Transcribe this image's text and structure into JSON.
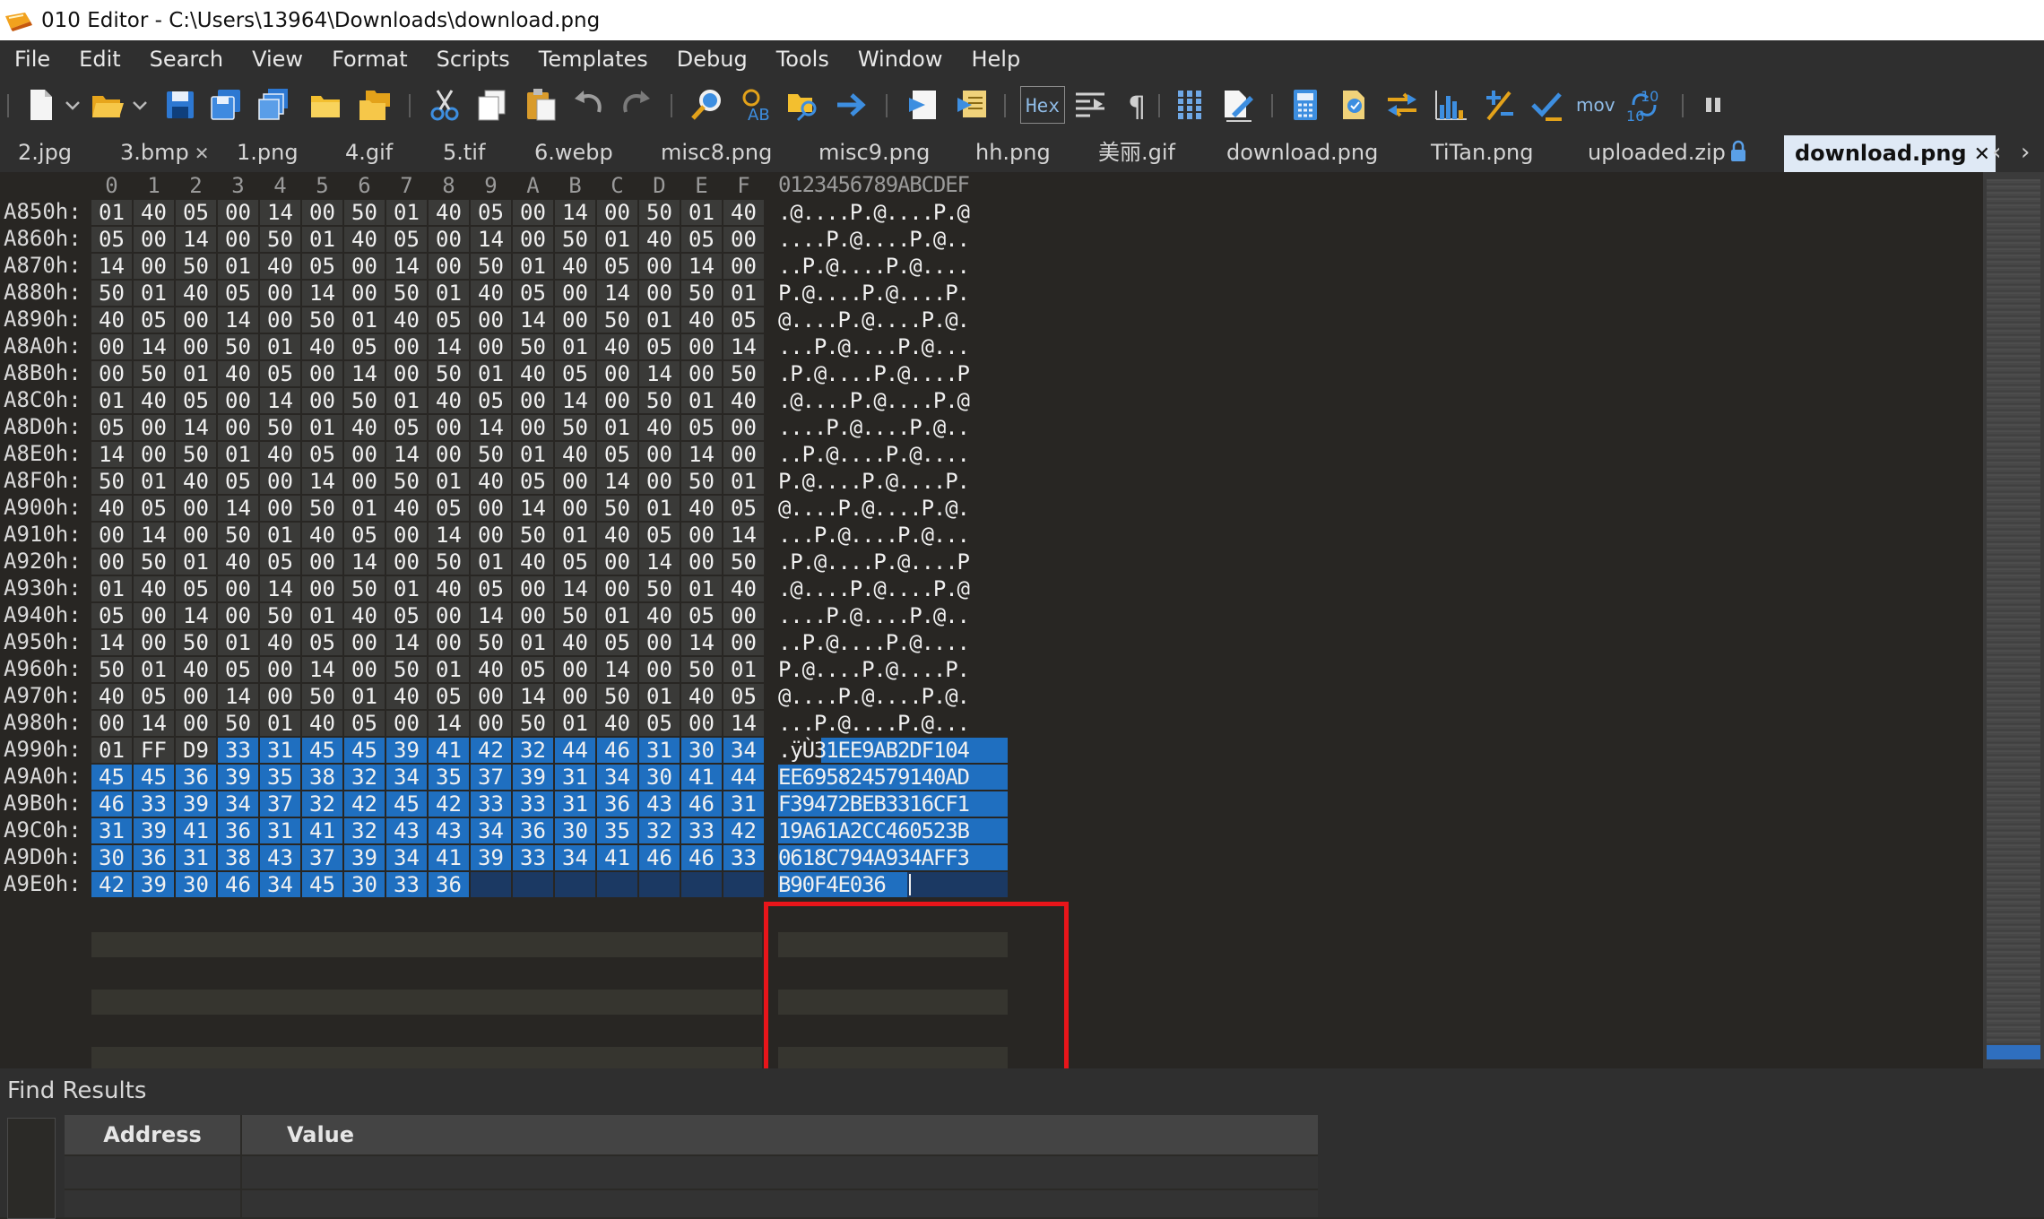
{
  "window": {
    "title": "010 Editor - C:\\Users\\13964\\Downloads\\download.png"
  },
  "menu": [
    "File",
    "Edit",
    "Search",
    "View",
    "Format",
    "Scripts",
    "Templates",
    "Debug",
    "Tools",
    "Window",
    "Help"
  ],
  "toolbar": {
    "hex_label": "Hex",
    "mov_label": "mov",
    "icons": [
      "new-file-icon",
      "new-dropdown-icon",
      "open-file-icon",
      "open-dropdown-icon",
      "save-icon",
      "save-as-icon",
      "save-all-icon",
      "open-folder-icon",
      "open-multiple-icon",
      "cut-icon",
      "copy-icon",
      "paste-icon",
      "undo-icon",
      "redo-icon",
      "find-icon",
      "replace-icon",
      "find-in-files-icon",
      "goto-icon",
      "bookmark-icon",
      "template-icon",
      "hex-toggle",
      "columns-icon",
      "show-whitespace-icon",
      "column-mode-icon",
      "highlight-icon",
      "calculator-icon",
      "compare-icon",
      "swap-bytes-icon",
      "histogram-icon",
      "checksum-icon",
      "checkmark-icon",
      "mov-icon",
      "base-converter-icon",
      "pause-icon"
    ]
  },
  "tabs": [
    {
      "label": "2.jpg",
      "active": false
    },
    {
      "label": "3.bmp",
      "active": false,
      "closable": true
    },
    {
      "label": "1.png",
      "active": false
    },
    {
      "label": "4.gif",
      "active": false
    },
    {
      "label": "5.tif",
      "active": false
    },
    {
      "label": "6.webp",
      "active": false
    },
    {
      "label": "misc8.png",
      "active": false
    },
    {
      "label": "misc9.png",
      "active": false
    },
    {
      "label": "hh.png",
      "active": false
    },
    {
      "label": "美丽.gif",
      "active": false
    },
    {
      "label": "download.png",
      "active": false
    },
    {
      "label": "TiTan.png",
      "active": false
    },
    {
      "label": "uploaded.zip",
      "active": false,
      "locked": true
    },
    {
      "label": "download.png",
      "active": true,
      "closable": true
    }
  ],
  "tab_nav": {
    "prev": "‹",
    "next": "›"
  },
  "hex_header": {
    "columns": [
      "0",
      "1",
      "2",
      "3",
      "4",
      "5",
      "6",
      "7",
      "8",
      "9",
      "A",
      "B",
      "C",
      "D",
      "E",
      "F"
    ],
    "ascii_header": "0123456789ABCDEF"
  },
  "hex_rows": [
    {
      "addr": "A850h:",
      "bytes": [
        "01",
        "40",
        "05",
        "00",
        "14",
        "00",
        "50",
        "01",
        "40",
        "05",
        "00",
        "14",
        "00",
        "50",
        "01",
        "40"
      ],
      "ascii": ".@....P.@....P.@"
    },
    {
      "addr": "A860h:",
      "bytes": [
        "05",
        "00",
        "14",
        "00",
        "50",
        "01",
        "40",
        "05",
        "00",
        "14",
        "00",
        "50",
        "01",
        "40",
        "05",
        "00"
      ],
      "ascii": "....P.@....P.@.."
    },
    {
      "addr": "A870h:",
      "bytes": [
        "14",
        "00",
        "50",
        "01",
        "40",
        "05",
        "00",
        "14",
        "00",
        "50",
        "01",
        "40",
        "05",
        "00",
        "14",
        "00"
      ],
      "ascii": "..P.@....P.@...."
    },
    {
      "addr": "A880h:",
      "bytes": [
        "50",
        "01",
        "40",
        "05",
        "00",
        "14",
        "00",
        "50",
        "01",
        "40",
        "05",
        "00",
        "14",
        "00",
        "50",
        "01"
      ],
      "ascii": "P.@....P.@....P."
    },
    {
      "addr": "A890h:",
      "bytes": [
        "40",
        "05",
        "00",
        "14",
        "00",
        "50",
        "01",
        "40",
        "05",
        "00",
        "14",
        "00",
        "50",
        "01",
        "40",
        "05"
      ],
      "ascii": "@....P.@....P.@."
    },
    {
      "addr": "A8A0h:",
      "bytes": [
        "00",
        "14",
        "00",
        "50",
        "01",
        "40",
        "05",
        "00",
        "14",
        "00",
        "50",
        "01",
        "40",
        "05",
        "00",
        "14"
      ],
      "ascii": "...P.@....P.@..."
    },
    {
      "addr": "A8B0h:",
      "bytes": [
        "00",
        "50",
        "01",
        "40",
        "05",
        "00",
        "14",
        "00",
        "50",
        "01",
        "40",
        "05",
        "00",
        "14",
        "00",
        "50"
      ],
      "ascii": ".P.@....P.@....P"
    },
    {
      "addr": "A8C0h:",
      "bytes": [
        "01",
        "40",
        "05",
        "00",
        "14",
        "00",
        "50",
        "01",
        "40",
        "05",
        "00",
        "14",
        "00",
        "50",
        "01",
        "40"
      ],
      "ascii": ".@....P.@....P.@"
    },
    {
      "addr": "A8D0h:",
      "bytes": [
        "05",
        "00",
        "14",
        "00",
        "50",
        "01",
        "40",
        "05",
        "00",
        "14",
        "00",
        "50",
        "01",
        "40",
        "05",
        "00"
      ],
      "ascii": "....P.@....P.@.."
    },
    {
      "addr": "A8E0h:",
      "bytes": [
        "14",
        "00",
        "50",
        "01",
        "40",
        "05",
        "00",
        "14",
        "00",
        "50",
        "01",
        "40",
        "05",
        "00",
        "14",
        "00"
      ],
      "ascii": "..P.@....P.@...."
    },
    {
      "addr": "A8F0h:",
      "bytes": [
        "50",
        "01",
        "40",
        "05",
        "00",
        "14",
        "00",
        "50",
        "01",
        "40",
        "05",
        "00",
        "14",
        "00",
        "50",
        "01"
      ],
      "ascii": "P.@....P.@....P."
    },
    {
      "addr": "A900h:",
      "bytes": [
        "40",
        "05",
        "00",
        "14",
        "00",
        "50",
        "01",
        "40",
        "05",
        "00",
        "14",
        "00",
        "50",
        "01",
        "40",
        "05"
      ],
      "ascii": "@....P.@....P.@."
    },
    {
      "addr": "A910h:",
      "bytes": [
        "00",
        "14",
        "00",
        "50",
        "01",
        "40",
        "05",
        "00",
        "14",
        "00",
        "50",
        "01",
        "40",
        "05",
        "00",
        "14"
      ],
      "ascii": "...P.@....P.@..."
    },
    {
      "addr": "A920h:",
      "bytes": [
        "00",
        "50",
        "01",
        "40",
        "05",
        "00",
        "14",
        "00",
        "50",
        "01",
        "40",
        "05",
        "00",
        "14",
        "00",
        "50"
      ],
      "ascii": ".P.@....P.@....P"
    },
    {
      "addr": "A930h:",
      "bytes": [
        "01",
        "40",
        "05",
        "00",
        "14",
        "00",
        "50",
        "01",
        "40",
        "05",
        "00",
        "14",
        "00",
        "50",
        "01",
        "40"
      ],
      "ascii": ".@....P.@....P.@"
    },
    {
      "addr": "A940h:",
      "bytes": [
        "05",
        "00",
        "14",
        "00",
        "50",
        "01",
        "40",
        "05",
        "00",
        "14",
        "00",
        "50",
        "01",
        "40",
        "05",
        "00"
      ],
      "ascii": "....P.@....P.@.."
    },
    {
      "addr": "A950h:",
      "bytes": [
        "14",
        "00",
        "50",
        "01",
        "40",
        "05",
        "00",
        "14",
        "00",
        "50",
        "01",
        "40",
        "05",
        "00",
        "14",
        "00"
      ],
      "ascii": "..P.@....P.@...."
    },
    {
      "addr": "A960h:",
      "bytes": [
        "50",
        "01",
        "40",
        "05",
        "00",
        "14",
        "00",
        "50",
        "01",
        "40",
        "05",
        "00",
        "14",
        "00",
        "50",
        "01"
      ],
      "ascii": "P.@....P.@....P."
    },
    {
      "addr": "A970h:",
      "bytes": [
        "40",
        "05",
        "00",
        "14",
        "00",
        "50",
        "01",
        "40",
        "05",
        "00",
        "14",
        "00",
        "50",
        "01",
        "40",
        "05"
      ],
      "ascii": "@....P.@....P.@."
    },
    {
      "addr": "A980h:",
      "bytes": [
        "00",
        "14",
        "00",
        "50",
        "01",
        "40",
        "05",
        "00",
        "14",
        "00",
        "50",
        "01",
        "40",
        "05",
        "00",
        "14"
      ],
      "ascii": "...P.@....P.@..."
    },
    {
      "addr": "A990h:",
      "bytes": [
        "01",
        "FF",
        "D9",
        "33",
        "31",
        "45",
        "45",
        "39",
        "41",
        "42",
        "32",
        "44",
        "46",
        "31",
        "30",
        "34"
      ],
      "ascii": ".ÿÙ31EE9AB2DF104",
      "sel_from": 3
    },
    {
      "addr": "A9A0h:",
      "bytes": [
        "45",
        "45",
        "36",
        "39",
        "35",
        "38",
        "32",
        "34",
        "35",
        "37",
        "39",
        "31",
        "34",
        "30",
        "41",
        "44"
      ],
      "ascii": "EE695824579140AD",
      "sel_from": 0
    },
    {
      "addr": "A9B0h:",
      "bytes": [
        "46",
        "33",
        "39",
        "34",
        "37",
        "32",
        "42",
        "45",
        "42",
        "33",
        "33",
        "31",
        "36",
        "43",
        "46",
        "31"
      ],
      "ascii": "F39472BEB3316CF1",
      "sel_from": 0
    },
    {
      "addr": "A9C0h:",
      "bytes": [
        "31",
        "39",
        "41",
        "36",
        "31",
        "41",
        "32",
        "43",
        "43",
        "34",
        "36",
        "30",
        "35",
        "32",
        "33",
        "42"
      ],
      "ascii": "19A61A2CC460523B",
      "sel_from": 0
    },
    {
      "addr": "A9D0h:",
      "bytes": [
        "30",
        "36",
        "31",
        "38",
        "43",
        "37",
        "39",
        "34",
        "41",
        "39",
        "33",
        "34",
        "41",
        "46",
        "46",
        "33"
      ],
      "ascii": "0618C794A934AFF3",
      "sel_from": 0
    },
    {
      "addr": "A9E0h:",
      "bytes": [
        "42",
        "39",
        "30",
        "46",
        "34",
        "45",
        "30",
        "33",
        "36"
      ],
      "ascii": "B90F4E036",
      "sel_from": 0,
      "last": true
    }
  ],
  "find_results": {
    "title": "Find Results",
    "columns": [
      "Address",
      "Value"
    ]
  },
  "colors": {
    "selection": "#1f6fc0",
    "highlight_box": "#e8151a",
    "editor_bg": "#282623",
    "cell_bg": "#3a3a38",
    "active_tab_bg": "#dfe9f5"
  }
}
